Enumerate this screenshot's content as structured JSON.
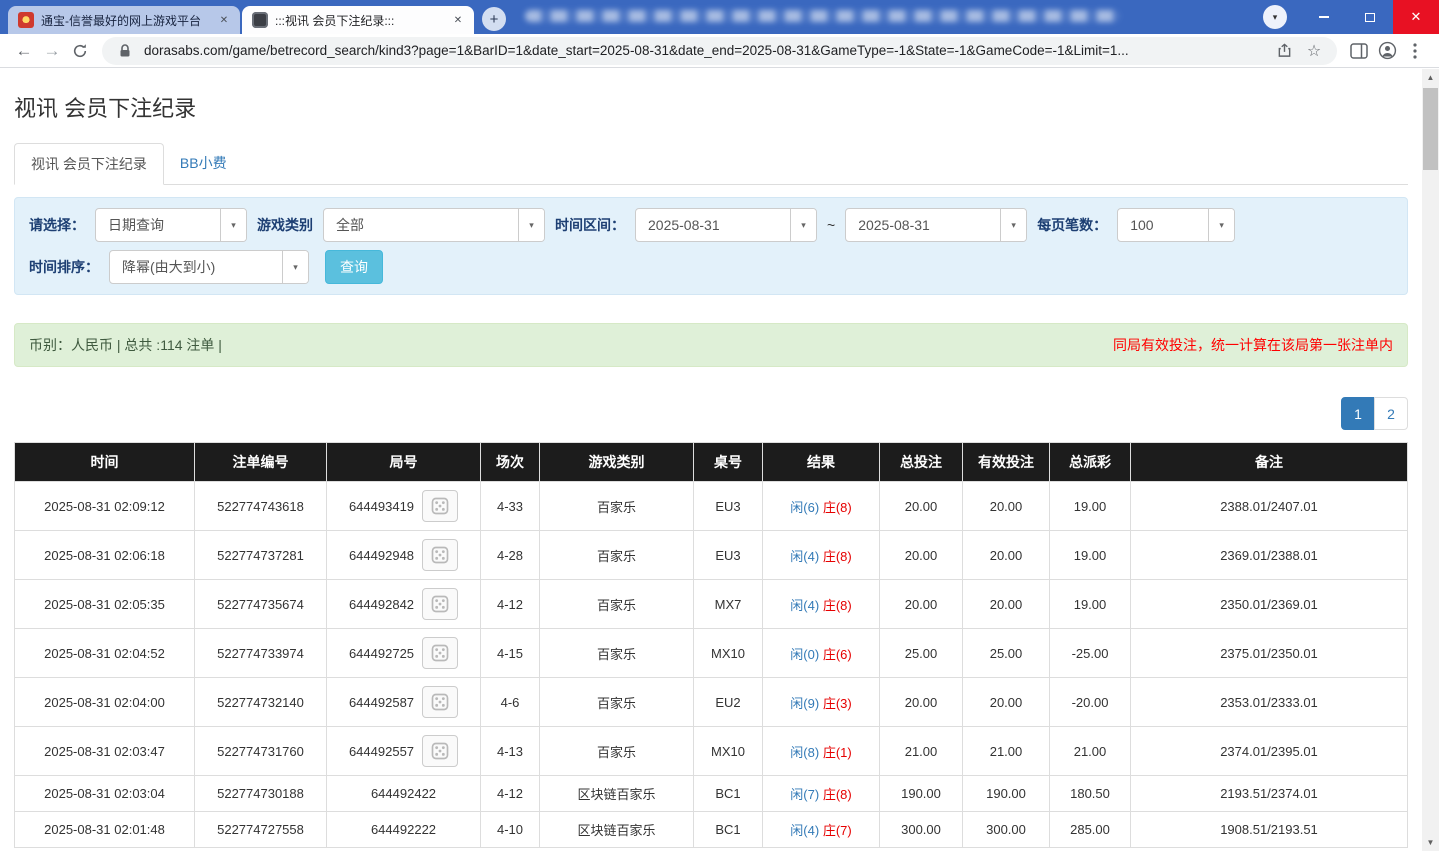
{
  "colors": {
    "accent_blue": "#337ab7",
    "banker_red": "#e60000",
    "negative_red": "#ff0000",
    "table_header_bg": "#1c1c1c",
    "search_button_teal": "#5bc0de",
    "titlebar_blue": "#3a68bf"
  },
  "icons": {
    "caret_down": "▾",
    "close": "✕",
    "new_tab": "+",
    "back": "←",
    "forward": "→",
    "star": "☆",
    "scroll_up": "▲",
    "scroll_down": "▼"
  },
  "browser": {
    "tabs": [
      {
        "title": "通宝-信誉最好的网上游戏平台"
      },
      {
        "title": ":::视讯 会员下注纪录:::"
      }
    ],
    "url": "dorasabs.com/game/betrecord_search/kind3?page=1&BarID=1&date_start=2025-08-31&date_end=2025-08-31&GameType=-1&State=-1&GameCode=-1&Limit=1..."
  },
  "page": {
    "title": "视讯 会员下注纪录",
    "tabs": [
      {
        "label": "视讯 会员下注纪录"
      },
      {
        "label": "BB小费"
      }
    ],
    "filters": {
      "select_label": "请选择：",
      "select_value": "日期查询",
      "game_label": "游戏类别",
      "game_value": "全部",
      "range_label": "时间区间：",
      "date_start": "2025-08-31",
      "range_sep": "~",
      "date_end": "2025-08-31",
      "per_page_label": "每页笔数：",
      "per_page_value": "100",
      "sort_label": "时间排序：",
      "sort_value": "降幂(由大到小)",
      "search_button": "查询"
    },
    "info_bar": {
      "left": "币别：人民币 | 总共 :114 注单 |",
      "right": "同局有效投注，统一计算在该局第一张注单内"
    },
    "pagination": {
      "pages": [
        "1",
        "2"
      ],
      "active": "1"
    },
    "table": {
      "headers": [
        "时间",
        "注单编号",
        "局号",
        "场次",
        "游戏类别",
        "桌号",
        "结果",
        "总投注",
        "有效投注",
        "总派彩",
        "备注"
      ],
      "rows": [
        {
          "time": "2025-08-31 02:09:12",
          "bet_id": "522774743618",
          "round_id": "644493419",
          "has_replay": true,
          "session": "4-33",
          "game_type": "百家乐",
          "table_no": "EU3",
          "result_player": "闲(6)",
          "result_banker": "庄(8)",
          "total_bet": "20.00",
          "valid_bet": "20.00",
          "payout": "19.00",
          "note": "2388.01/2407.01"
        },
        {
          "time": "2025-08-31 02:06:18",
          "bet_id": "522774737281",
          "round_id": "644492948",
          "has_replay": true,
          "session": "4-28",
          "game_type": "百家乐",
          "table_no": "EU3",
          "result_player": "闲(4)",
          "result_banker": "庄(8)",
          "total_bet": "20.00",
          "valid_bet": "20.00",
          "payout": "19.00",
          "note": "2369.01/2388.01"
        },
        {
          "time": "2025-08-31 02:05:35",
          "bet_id": "522774735674",
          "round_id": "644492842",
          "has_replay": true,
          "session": "4-12",
          "game_type": "百家乐",
          "table_no": "MX7",
          "result_player": "闲(4)",
          "result_banker": "庄(8)",
          "total_bet": "20.00",
          "valid_bet": "20.00",
          "payout": "19.00",
          "note": "2350.01/2369.01"
        },
        {
          "time": "2025-08-31 02:04:52",
          "bet_id": "522774733974",
          "round_id": "644492725",
          "has_replay": true,
          "session": "4-15",
          "game_type": "百家乐",
          "table_no": "MX10",
          "result_player": "闲(0)",
          "result_banker": "庄(6)",
          "total_bet": "25.00",
          "valid_bet": "25.00",
          "payout": "-25.00",
          "note": "2375.01/2350.01"
        },
        {
          "time": "2025-08-31 02:04:00",
          "bet_id": "522774732140",
          "round_id": "644492587",
          "has_replay": true,
          "session": "4-6",
          "game_type": "百家乐",
          "table_no": "EU2",
          "result_player": "闲(9)",
          "result_banker": "庄(3)",
          "total_bet": "20.00",
          "valid_bet": "20.00",
          "payout": "-20.00",
          "note": "2353.01/2333.01"
        },
        {
          "time": "2025-08-31 02:03:47",
          "bet_id": "522774731760",
          "round_id": "644492557",
          "has_replay": true,
          "session": "4-13",
          "game_type": "百家乐",
          "table_no": "MX10",
          "result_player": "闲(8)",
          "result_banker": "庄(1)",
          "total_bet": "21.00",
          "valid_bet": "21.00",
          "payout": "21.00",
          "note": "2374.01/2395.01"
        },
        {
          "time": "2025-08-31 02:03:04",
          "bet_id": "522774730188",
          "round_id": "644492422",
          "has_replay": false,
          "session": "4-12",
          "game_type": "区块链百家乐",
          "table_no": "BC1",
          "result_player": "闲(7)",
          "result_banker": "庄(8)",
          "total_bet": "190.00",
          "valid_bet": "190.00",
          "payout": "180.50",
          "note": "2193.51/2374.01"
        },
        {
          "time": "2025-08-31 02:01:48",
          "bet_id": "522774727558",
          "round_id": "644492222",
          "has_replay": false,
          "session": "4-10",
          "game_type": "区块链百家乐",
          "table_no": "BC1",
          "result_player": "闲(4)",
          "result_banker": "庄(7)",
          "total_bet": "300.00",
          "valid_bet": "300.00",
          "payout": "285.00",
          "note": "1908.51/2193.51"
        }
      ]
    }
  }
}
